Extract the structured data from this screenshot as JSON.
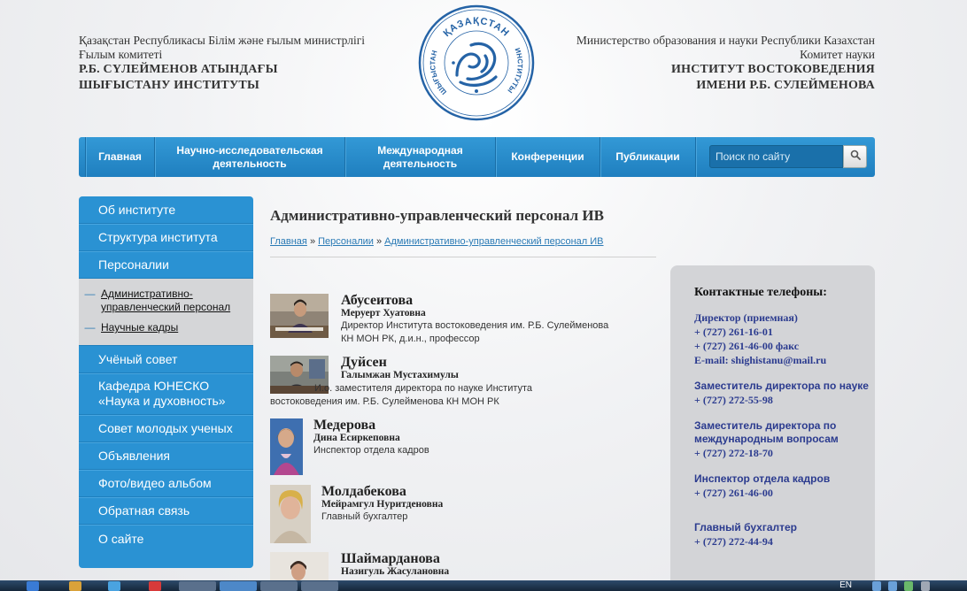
{
  "header": {
    "left": {
      "line1": "Қазақстан Республикасы Білім және ғылым министрлігі",
      "line2": "Ғылым комитеті",
      "line3": "Р.Б. СҮЛЕЙМЕНОВ АТЫНДАҒЫ",
      "line4": "ШЫҒЫСТАНУ ИНСТИТУТЫ"
    },
    "right": {
      "line1": "Министерство образования и науки Республики Казахстан",
      "line2": "Комитет науки",
      "line3": "ИНСТИТУТ ВОСТОКОВЕДЕНИЯ",
      "line4": "ИМЕНИ Р.Б. СУЛЕЙМЕНОВА"
    },
    "logo": {
      "top_text": "ҚАЗАҚСТАН",
      "left_text": "ШЫҒЫСТАНУ",
      "right_text": "ИНСТИТУТЫ"
    }
  },
  "nav": {
    "items": [
      "Главная",
      "Научно-исследовательская деятельность",
      "Международная деятельность",
      "Конференции",
      "Публикации"
    ],
    "search_placeholder": "Поиск по сайту"
  },
  "sidebar": {
    "items_top": [
      "Об институте",
      "Структура института",
      "Персоналии"
    ],
    "sub_items": [
      "Административно-управленческий персонал",
      "Научные кадры"
    ],
    "items_bottom": [
      "Учёный совет",
      "Кафедра ЮНЕСКО «Наука и духовность»",
      "Совет молодых ученых",
      "Объявления",
      "Фото/видео альбом",
      "Обратная связь",
      "О сайте"
    ]
  },
  "main": {
    "title": "Административно-управленческий персонал ИВ",
    "breadcrumb": {
      "home": "Главная",
      "sep": "»",
      "section": "Персоналии",
      "current": "Административно-управленческий персонал ИВ"
    },
    "people": [
      {
        "surname": "Абусеитова",
        "name": "Меруерт Хуатовна",
        "role": [
          "Директор Института востоковедения им. Р.Б. Сулейменова",
          "КН МОН РК, д.и.н., профессор"
        ]
      },
      {
        "surname": "Дуйсен",
        "name": "Галымжан Мустахимулы",
        "role": [
          "И.о. заместителя директора по науке Института",
          "востоковедения им. Р.Б. Сулейменова КН МОН РК"
        ]
      },
      {
        "surname": "Медерова",
        "name": "Дина Есиркеповна",
        "role": [
          "Инспектор отдела кадров"
        ]
      },
      {
        "surname": "Молдабекова",
        "name": "Мейрамгул Нуритденовна",
        "role": [
          "Главный бухгалтер"
        ]
      },
      {
        "surname": "Шаймарданова",
        "name": "Назигуль Жасулановна",
        "role": []
      }
    ]
  },
  "contacts": {
    "title": "Контактные телефоны:",
    "director_label": "Директор (приемная)",
    "director_phone1": "+ (727) 261-16-01",
    "director_phone2": "+ (727) 261-46-00 факс",
    "email": "E-mail: shighistanu@mail.ru",
    "deputy_science_label": "Заместитель директора по науке",
    "deputy_science_phone": "+ (727) 272-55-98",
    "deputy_intl_label": "Заместитель директора по международным вопросам",
    "deputy_intl_phone": "+ (727) 272-18-70",
    "hr_label": "Инспектор отдела кадров",
    "hr_phone": "+ (727) 261-46-00",
    "accountant_label": "Главный бухгалтер",
    "accountant_phone": "+ (727) 272-44-94"
  },
  "taskbar": {
    "lang": "EN"
  }
}
